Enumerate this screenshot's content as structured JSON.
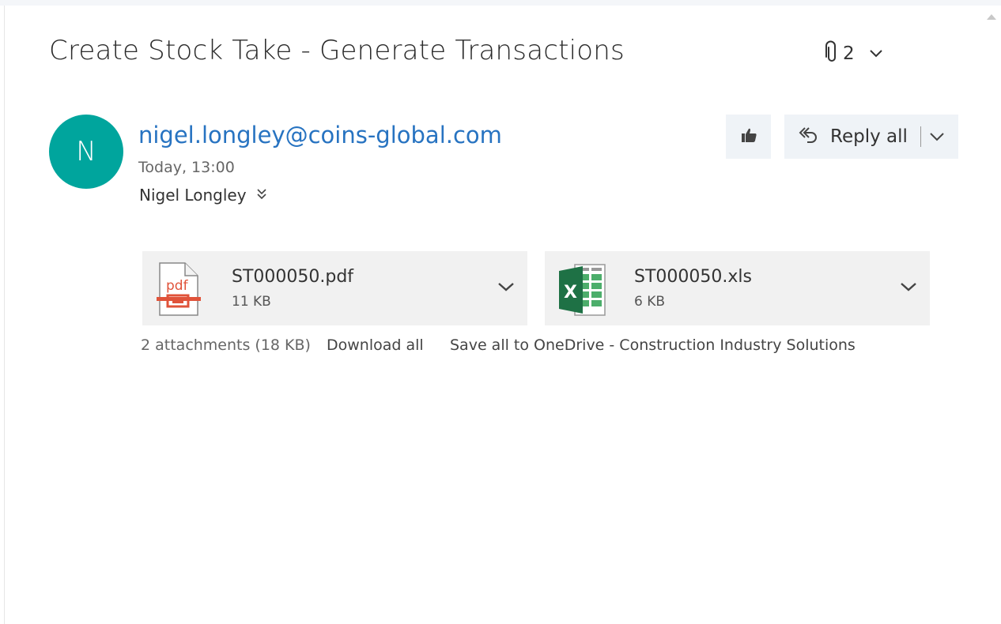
{
  "message": {
    "subject": "Create Stock Take - Generate Transactions",
    "attachment_count": "2",
    "sender": {
      "initial": "N",
      "email": "nigel.longley@coins-global.com",
      "sent_time": "Today, 13:00",
      "to": "Nigel Longley",
      "avatar_color": "#00a59d"
    }
  },
  "actions": {
    "like_icon": "thumbs-up-icon",
    "reply_all_label": "Reply all"
  },
  "attachments": {
    "items": [
      {
        "name": "ST000050.pdf",
        "size": "11 KB",
        "icon": "pdf-file-icon"
      },
      {
        "name": "ST000050.xls",
        "size": "6 KB",
        "icon": "excel-file-icon"
      }
    ],
    "summary": "2 attachments (18 KB)",
    "download_all": "Download all",
    "save_all": "Save all to OneDrive - Construction Industry Solutions"
  },
  "colors": {
    "link": "#2773c1",
    "button_bg": "#eff3f7",
    "card_bg": "#f1f1f1",
    "pdf_red": "#e0533a",
    "excel_green": "#1e7145"
  }
}
